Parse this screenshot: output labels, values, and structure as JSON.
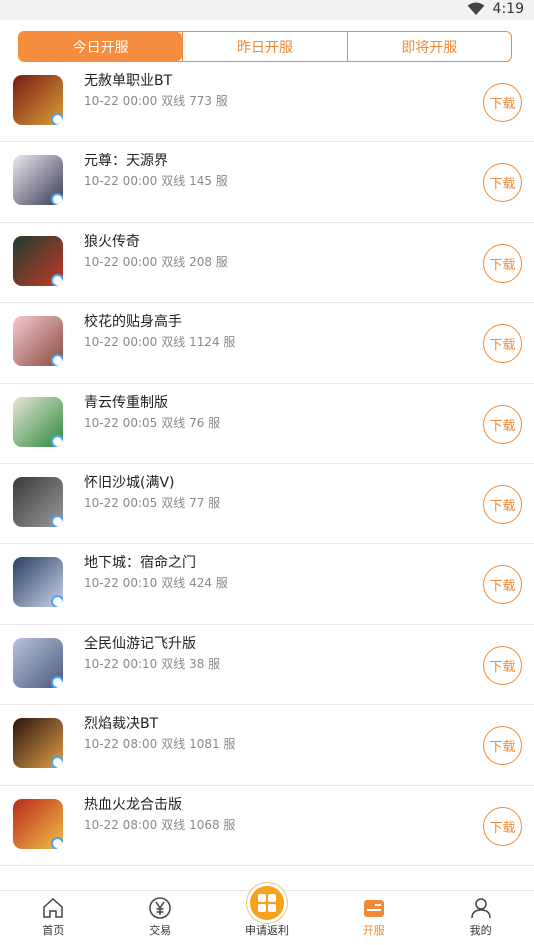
{
  "status_bar": {
    "time": "4:19"
  },
  "tabs": [
    {
      "label": "今日开服",
      "active": true
    },
    {
      "label": "昨日开服",
      "active": false
    },
    {
      "label": "即将开服",
      "active": false
    }
  ],
  "download_label": "下载",
  "games": [
    {
      "name": "无赦单职业BT",
      "date": "10-22 00:00",
      "server": "双线 773 服",
      "icon_colors": [
        "#7a1a12",
        "#d8a13a"
      ]
    },
    {
      "name": "元尊：天源界",
      "date": "10-22 00:00",
      "server": "双线 145 服",
      "icon_colors": [
        "#e9e9ef",
        "#3b3b55"
      ]
    },
    {
      "name": "狼火传奇",
      "date": "10-22 00:00",
      "server": "双线 208 服",
      "icon_colors": [
        "#1f3b2c",
        "#c23b2a"
      ]
    },
    {
      "name": "校花的贴身高手",
      "date": "10-22 00:00",
      "server": "双线 1124 服",
      "icon_colors": [
        "#f5c9d2",
        "#8a4a3a"
      ]
    },
    {
      "name": "青云传重制版",
      "date": "10-22 00:05",
      "server": "双线 76 服",
      "icon_colors": [
        "#e8e4d6",
        "#2d8a3c"
      ]
    },
    {
      "name": "怀旧沙城(满V)",
      "date": "10-22 00:05",
      "server": "双线 77 服",
      "icon_colors": [
        "#3a3a3a",
        "#9a9a9a"
      ]
    },
    {
      "name": "地下城：宿命之门",
      "date": "10-22 00:10",
      "server": "双线 424 服",
      "icon_colors": [
        "#2b3d63",
        "#c8d4e8"
      ]
    },
    {
      "name": "全民仙游记飞升版",
      "date": "10-22 00:10",
      "server": "双线 38 服",
      "icon_colors": [
        "#b9c4dc",
        "#4a5a7e"
      ]
    },
    {
      "name": "烈焰裁决BT",
      "date": "10-22 08:00",
      "server": "双线 1081 服",
      "icon_colors": [
        "#2a1410",
        "#e0a046"
      ]
    },
    {
      "name": "热血火龙合击版",
      "date": "10-22 08:00",
      "server": "双线 1068 服",
      "icon_colors": [
        "#b8281a",
        "#f2c04a"
      ]
    }
  ],
  "bottom_nav": [
    {
      "label": "首页",
      "icon": "home-icon",
      "active": false
    },
    {
      "label": "交易",
      "icon": "yen-icon",
      "active": false
    },
    {
      "label": "申请返利",
      "icon": "grid-icon",
      "active": false
    },
    {
      "label": "开服",
      "icon": "server-icon",
      "active": true
    },
    {
      "label": "我的",
      "icon": "user-icon",
      "active": false
    }
  ],
  "colors": {
    "accent": "#f08a38",
    "fab": "#f7a21a"
  }
}
